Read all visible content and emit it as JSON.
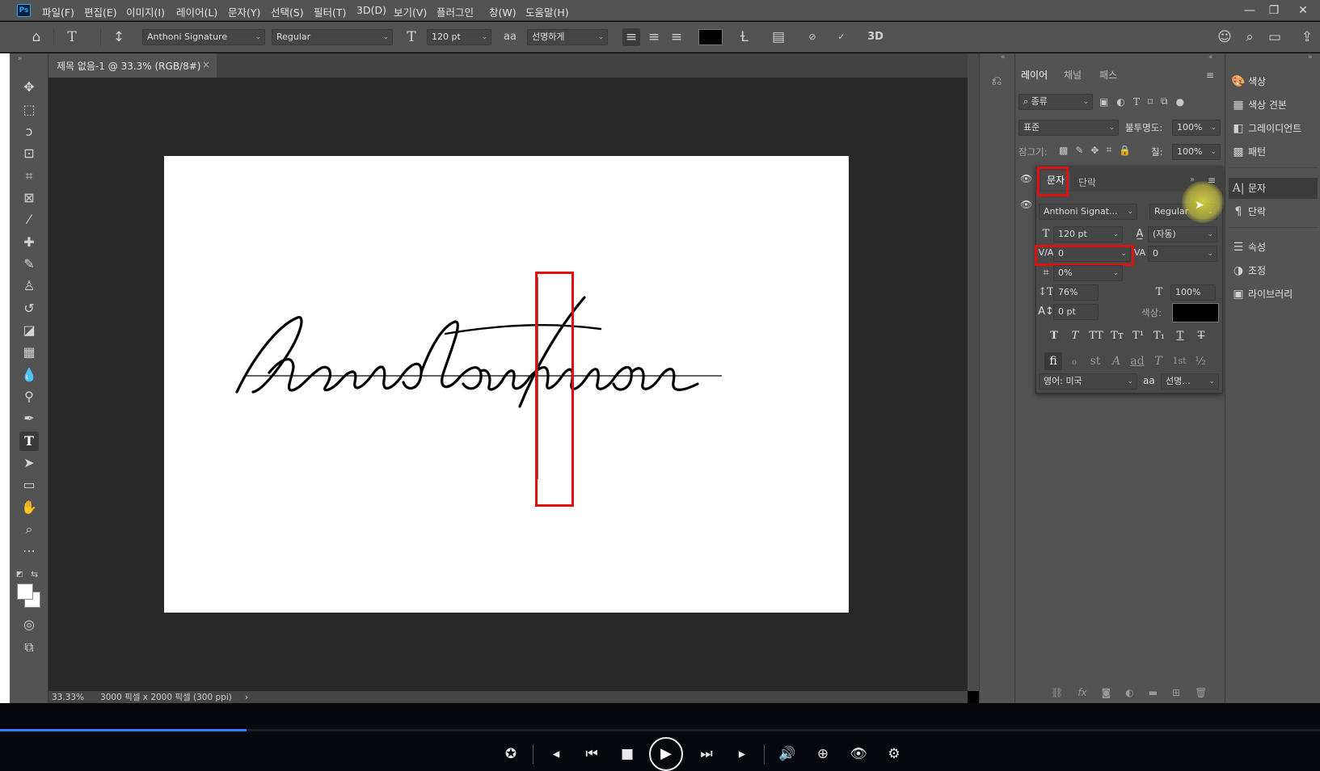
{
  "app": {
    "logo": "Ps",
    "menu": [
      "파일(F)",
      "편집(E)",
      "이미지(I)",
      "레이어(L)",
      "문자(Y)",
      "선택(S)",
      "필터(T)",
      "3D(D)",
      "보기(V)",
      "플러그인",
      "창(W)",
      "도움말(H)"
    ],
    "window_controls": [
      "—",
      "❐",
      "✕"
    ]
  },
  "options_bar": {
    "font_family": "Anthoni Signature",
    "font_style": "Regular",
    "font_size": "120 pt",
    "aa_label": "a",
    "anti_alias": "선명하게",
    "text_color": "#000000",
    "three_d": "3D"
  },
  "document": {
    "tab_title": "제목 없음-1 @ 33.3% (RGB/8#)",
    "close": "×",
    "zoom": "33.33%",
    "info": "3000 픽셀 x 2000 픽셀 (300 ppi)",
    "arrow": "›",
    "canvas_text": "handoutman"
  },
  "layers_panel": {
    "tabs": [
      "레이어",
      "채널",
      "패스"
    ],
    "filter_placeholder": "종류",
    "blend_mode": "표준",
    "opacity_label": "불투명도:",
    "opacity": "100%",
    "lock_label": "잠그기:",
    "fill_label": "칠:",
    "fill": "100%"
  },
  "character_panel": {
    "tabs": [
      "문자",
      "단락"
    ],
    "font_family": "Anthoni Signat...",
    "font_style": "Regular",
    "font_size": "120 pt",
    "leading": "(자동)",
    "kerning": "0",
    "tracking": "0",
    "tsume": "0%",
    "vertical_scale": "76%",
    "horizontal_scale": "100%",
    "baseline_shift": "0 pt",
    "color_label": "색상:",
    "color": "#000000",
    "language": "영어: 미국",
    "aa_label": "a",
    "anti_alias": "선명...",
    "format_buttons": [
      "T",
      "T",
      "TT",
      "Tт",
      "T¹",
      "T₁",
      "T",
      "T"
    ],
    "opentype_buttons": [
      "fi",
      "ℴ",
      "st",
      "A",
      "ad",
      "T",
      "1st",
      "½"
    ]
  },
  "side_panel": {
    "items": [
      "색상",
      "색상 견본",
      "그레이디언트",
      "패턴",
      "문자",
      "단락",
      "속성",
      "조정",
      "라이브러리"
    ]
  },
  "player": {
    "progress": 0.187
  },
  "colors": {
    "highlight_red": "#e01010",
    "progress_blue": "#2f7dff"
  }
}
